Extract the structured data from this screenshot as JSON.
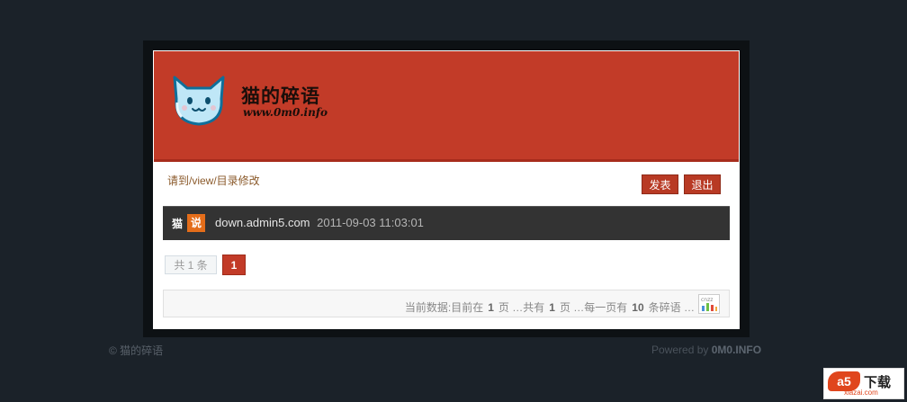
{
  "site": {
    "title": "猫的碎语",
    "url": "www.0m0.info"
  },
  "nav": {
    "breadcrumb": "请到/view/目录修改",
    "post_label": "发表",
    "logout_label": "退出"
  },
  "entry": {
    "category": "猫",
    "badge": "说",
    "text": "down.admin5.com",
    "time": "2011-09-03 11:03:01"
  },
  "pager": {
    "total": "共 1 条",
    "current": "1"
  },
  "stats": {
    "prefix": "当前数据:目前在",
    "current_page": "1",
    "page_label": "页 …共有",
    "total_pages": "1",
    "per_page_label": "页 …每一页有",
    "per_page": "10",
    "suffix": "条碎语 …"
  },
  "footer": {
    "copyright": "© 猫的碎语",
    "powered_prefix": "Powered by",
    "powered_name": "0M0.INFO"
  },
  "watermark": {
    "logo": "a5",
    "text": "下载",
    "sub": "xiazai.com"
  },
  "colors": {
    "banner": "#c23b28",
    "background": "#1b2229",
    "badge": "#e46d1a"
  }
}
